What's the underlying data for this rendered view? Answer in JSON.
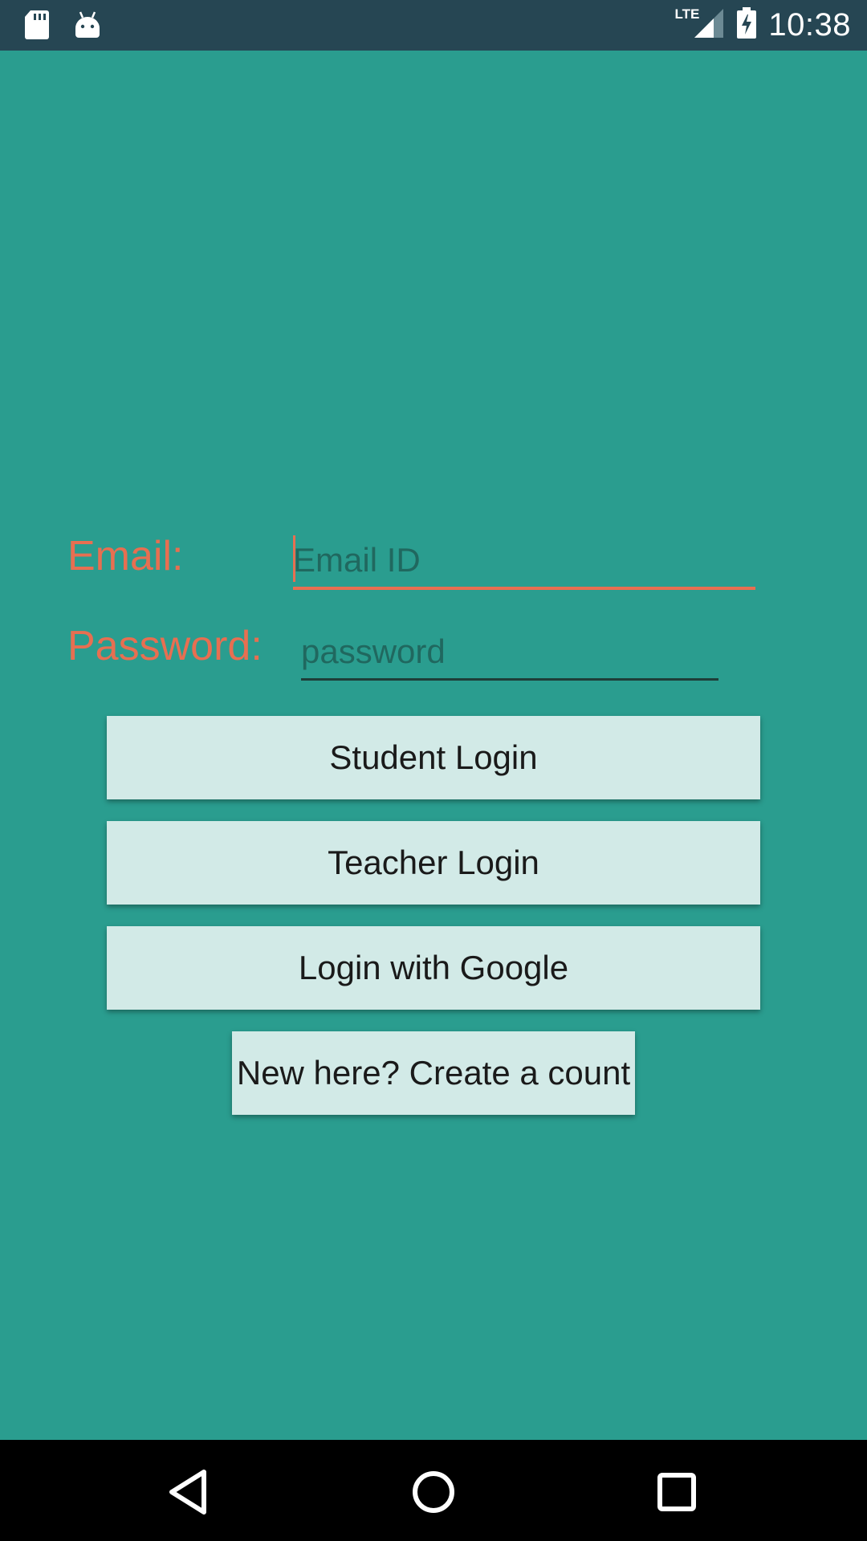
{
  "status_bar": {
    "time": "10:38",
    "network": "LTE",
    "icons": [
      "sd-card-icon",
      "android-icon",
      "signal-icon",
      "battery-charging-icon"
    ]
  },
  "form": {
    "email_label": "Email:",
    "email_placeholder": "Email ID",
    "email_value": "",
    "password_label": "Password:",
    "password_placeholder": "password",
    "password_value": ""
  },
  "buttons": {
    "student_login": "Student Login",
    "teacher_login": "Teacher Login",
    "google_login": "Login with Google",
    "create_account": "New here? Create a count"
  },
  "nav_bar": {
    "icons": [
      "back-icon",
      "home-icon",
      "recents-icon"
    ]
  },
  "colors": {
    "background": "#2a9d8f",
    "status_bar": "#264653",
    "accent": "#e76f51",
    "button": "#d2eae7"
  }
}
